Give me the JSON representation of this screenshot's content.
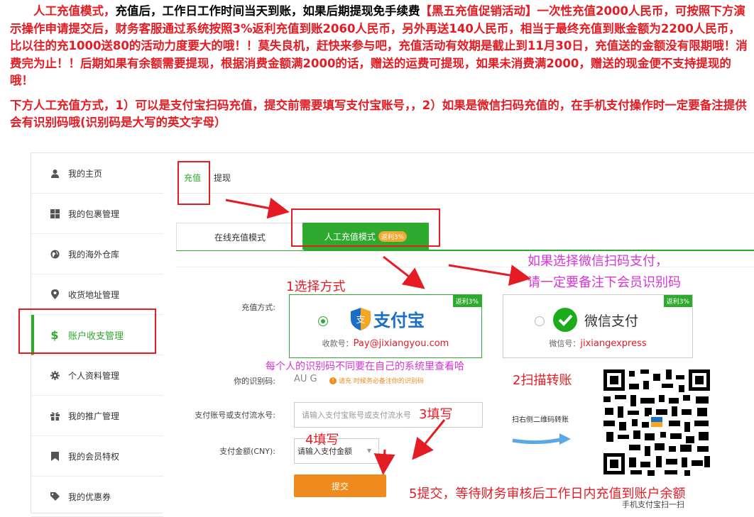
{
  "intro": {
    "p1_red1": "人工充值模式，",
    "p1_black1": "充值后，工作日工作时间当天到账，如果后期提现免手续费",
    "p1_red2": "【黑五充值促销活动】一次性充值2000人民币，可按照下方演示操作申请提交后，财务客服通过系统按照3%返利充值到账2060人民币，另外再送140人民币，相当于最终充值到账金额为2200人民币，比以往的充1000送80的活动力度要大的哦！！莫失良机，赶快来参与吧，充值活动有效期是截止到11月30日，充值送的金额没有限期哦！消费完为止！！后期如果有余额需要提现，根据消费金额满2000的话，赠送的运费可提现，如果未消费满2000，赠送的现金便不支持提现的哦！",
    "p2": "下方人工充值方式，1）可以是支付宝扫码充值，提交前需要填写支付宝账号，，2）如果是微信扫码充值的，在手机支付操作时一定要备注提供会有识别码哦(识别码是大写的英文字母）"
  },
  "sidebar": {
    "items": [
      {
        "label": "我的主页",
        "icon": "user-icon"
      },
      {
        "label": "我的包裹管理",
        "icon": "grid-icon"
      },
      {
        "label": "我的海外仓库",
        "icon": "globe-icon"
      },
      {
        "label": "收货地址管理",
        "icon": "location-pin-icon"
      },
      {
        "label": "账户收支管理",
        "icon": "dollar-icon"
      },
      {
        "label": "个人资料管理",
        "icon": "gear-icon"
      },
      {
        "label": "我的推广管理",
        "icon": "gift-icon"
      },
      {
        "label": "我的会员特权",
        "icon": "bookmark-icon"
      },
      {
        "label": "我的优惠券",
        "icon": "tag-icon"
      }
    ]
  },
  "tabs": {
    "recharge": "充值",
    "withdraw": "提现"
  },
  "modes": {
    "online": "在线充值模式",
    "manual": "人工充值模式",
    "manual_badge": "返利3%"
  },
  "form": {
    "method_label": "充值方式:",
    "alipay": {
      "badge": "返利3%",
      "brand": "支付宝",
      "account_label": "收款号：",
      "account": "Pay@jixiangyou.com"
    },
    "wechat": {
      "badge": "返利3%",
      "brand": "微信支付",
      "account_label": "微信号：",
      "account": "jixiangexpress"
    },
    "code_label": "你的识别码:",
    "code_value": "AU  G",
    "code_hint": "请充    时候务必备注你的识别码",
    "account_label": "支付账号或支付流水号:",
    "account_placeholder": "请输入支付宝账号或支付流水号",
    "amount_label": "支付金额(CNY):",
    "amount_value": "请输入支付金额",
    "submit": "提交",
    "scan_hint": "扫右侧二维码转账",
    "qr_caption": "手机支付宝扫一扫"
  },
  "annotations": {
    "step1": "1选择方式",
    "wechat_note_1": "如果选择微信扫码支付，",
    "wechat_note_2": "请一定要备注下会员识别码",
    "code_note": "每个人的识别码不同要在自己的系统里查看哈",
    "step2": "2扫描转账",
    "step3": "3填写",
    "step4": "4填写",
    "step5": "5提交，等待财务审核后工作日内充值到账户余额"
  },
  "colors": {
    "accent": "#2eaa2e",
    "annotation": "#e51c23",
    "note": "#d634d6",
    "button": "#ef8b1e"
  }
}
